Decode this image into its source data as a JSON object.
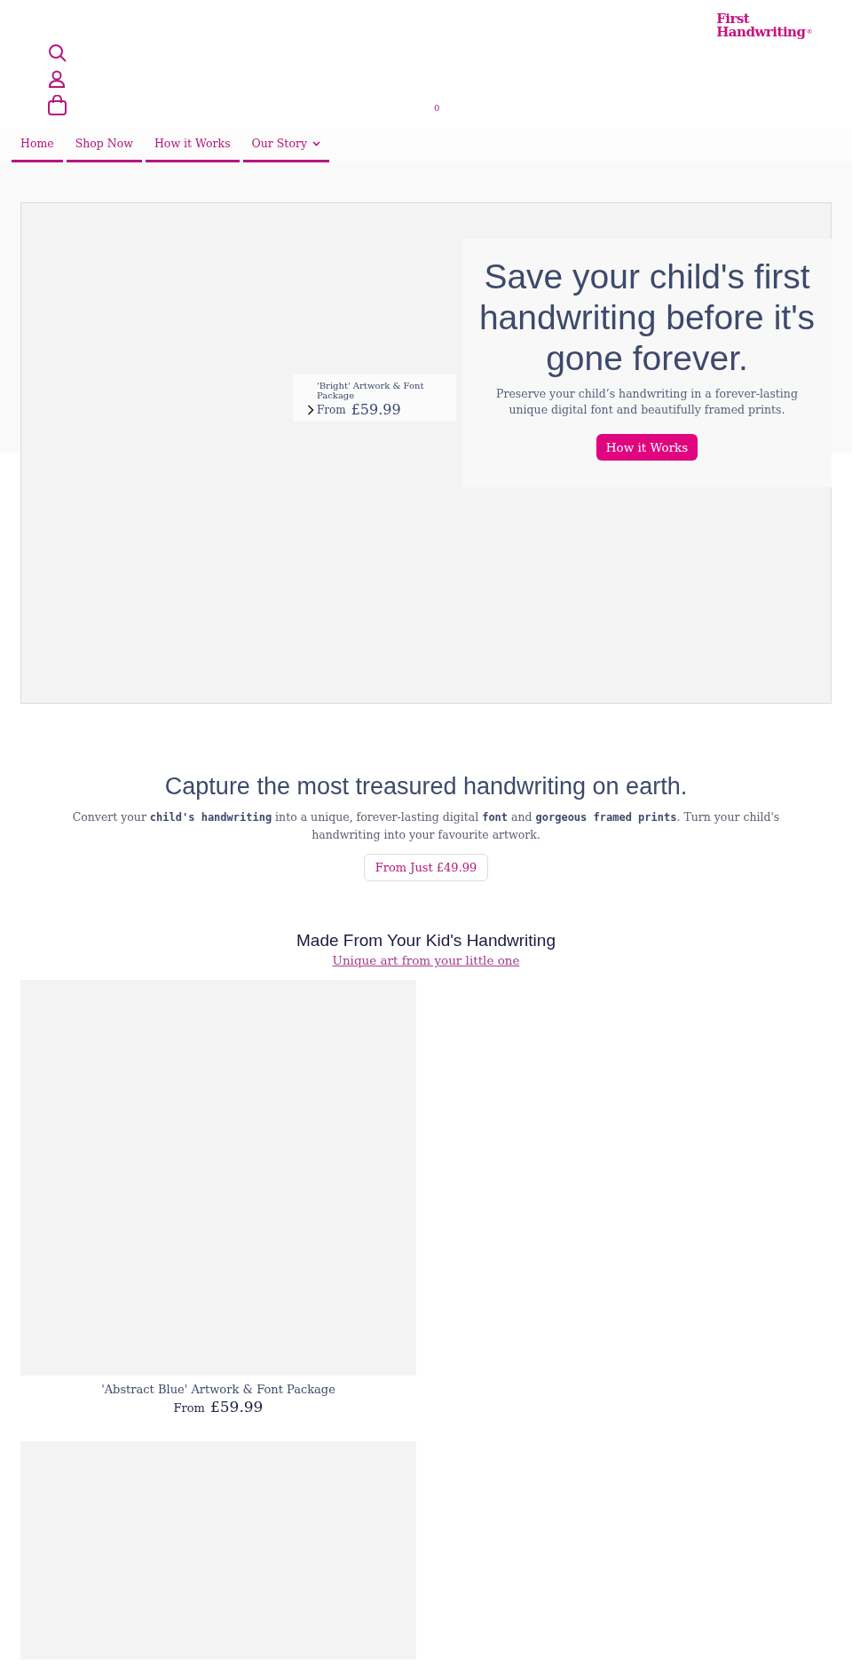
{
  "header": {
    "logo": [
      "First",
      "Handwriting"
    ],
    "logo_mark": "®",
    "cart_count": "0"
  },
  "nav": [
    {
      "label": "Home",
      "kind": "link"
    },
    {
      "label": "Shop Now",
      "kind": "link"
    },
    {
      "label": "How it Works",
      "kind": "link"
    },
    {
      "label": "Our Story",
      "kind": "dropdown"
    }
  ],
  "hero": {
    "product": {
      "title": "'Bright' Artwork & Font Package",
      "from": "From",
      "price": "£59.99"
    },
    "heading": "Save your child's first handwriting before it's gone forever.",
    "text": "Preserve your child’s handwriting in a forever-lasting unique digital font and beautifully framed prints.",
    "button": "How it Works"
  },
  "intro": {
    "heading": "Capture the most treasured handwriting on earth.",
    "text": "Convert your **child's handwriting** into a unique, forever-lasting digital **font**  and **gorgeous framed prints**. Turn your child's handwriting into your favourite artwork.",
    "button": "From Just £49.99"
  },
  "products_section": {
    "heading": "Made From Your Kid's Handwriting",
    "link": "Unique art from your little one",
    "products": [
      {
        "kind": "product",
        "title": "'Abstract Blue' Artwork & Font Package",
        "from": "From",
        "price": "£59.99"
      },
      {
        "kind": "picture"
      }
    ]
  }
}
